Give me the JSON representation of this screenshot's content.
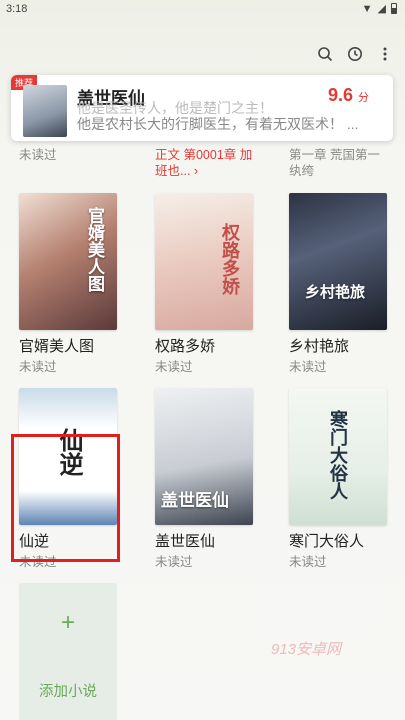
{
  "status_bar": {
    "time": "3:18"
  },
  "banner": {
    "tag": "推荐",
    "title": "盖世医仙",
    "desc_line1": "他是医圣传人，他是楚门之主！",
    "desc_line2": "他是农村长大的行脚医生，有着无双医术！ ...",
    "score": "9.6",
    "score_unit": "分"
  },
  "previous_row": {
    "cell1": "未读过",
    "cell2": "正文 第0001章 加班也... ›",
    "cell3": "第一章 荒国第一纨绔"
  },
  "books": [
    {
      "name": "官婿美人图",
      "status": "未读过",
      "cover_text": "官婿美人图"
    },
    {
      "name": "权路多娇",
      "status": "未读过",
      "cover_text": "权路多娇"
    },
    {
      "name": "乡村艳旅",
      "status": "未读过",
      "cover_text": "乡村艳旅"
    },
    {
      "name": "仙逆",
      "status": "未读过",
      "cover_text": "仙逆"
    },
    {
      "name": "盖世医仙",
      "status": "未读过",
      "cover_text": "盖世医仙"
    },
    {
      "name": "寒门大俗人",
      "status": "未读过",
      "cover_text": "寒门大俗人"
    }
  ],
  "add_card": {
    "plus": "+",
    "label": "添加小说"
  },
  "watermark": "913安卓网",
  "colors": {
    "accent_red": "#e53935",
    "add_green": "#6aaa5a"
  }
}
